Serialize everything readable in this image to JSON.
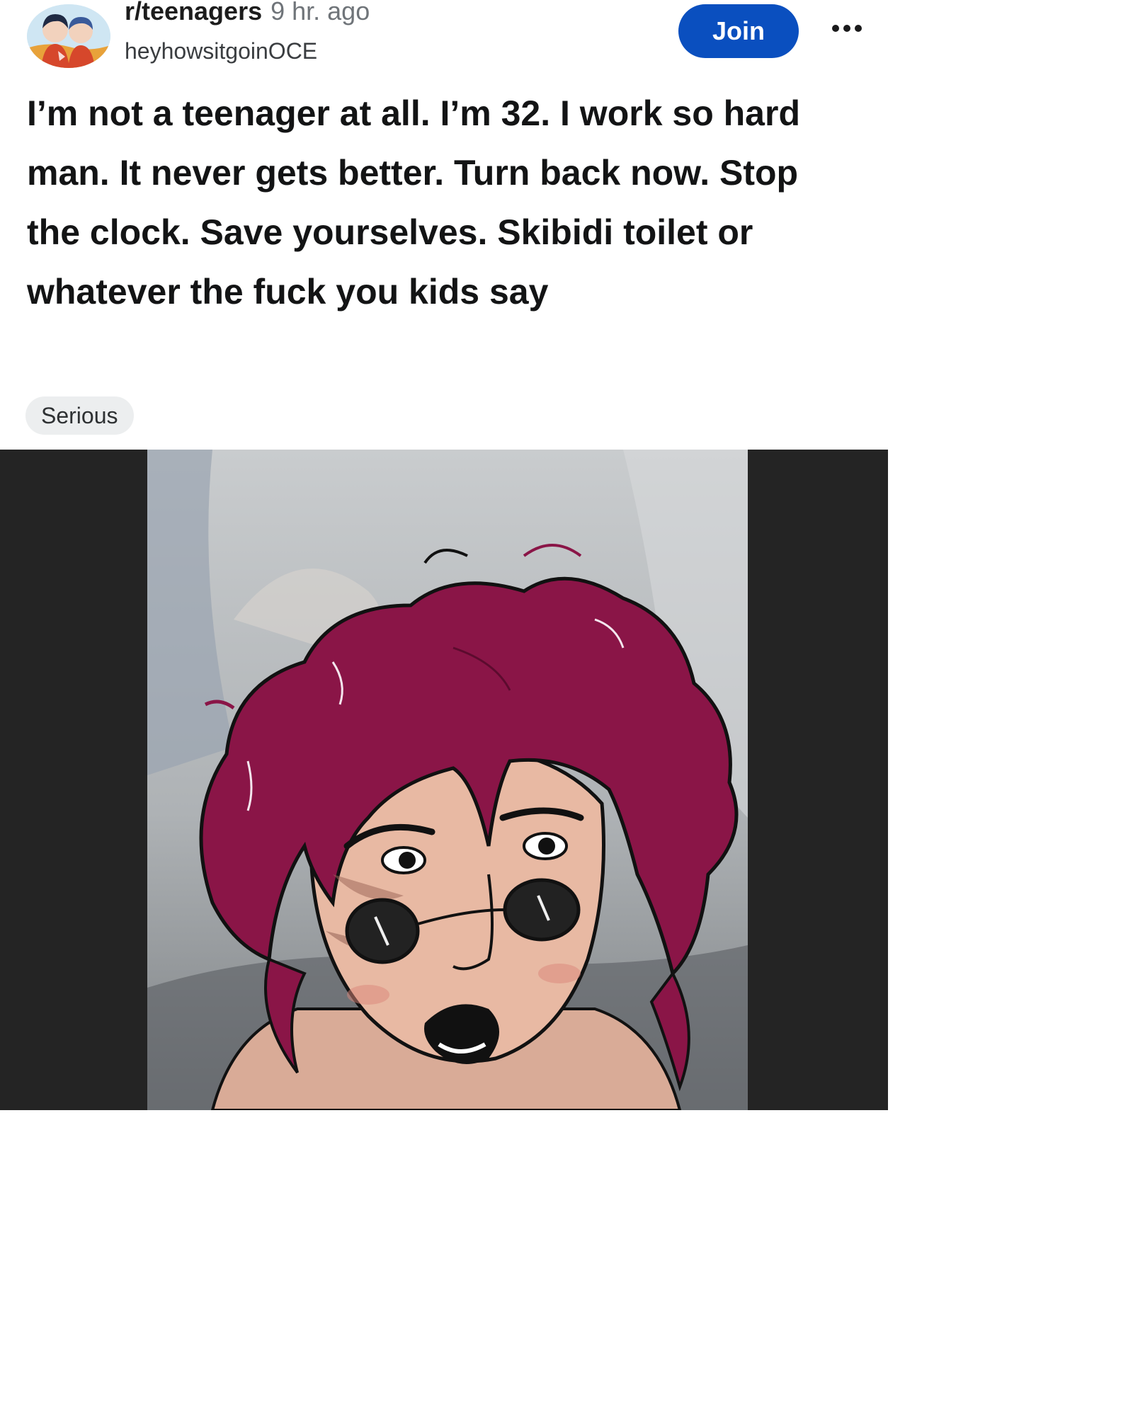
{
  "post": {
    "subreddit": "r/teenagers",
    "time_ago": "9 hr. ago",
    "username": "heyhowsitgoinOCE",
    "join_label": "Join",
    "title": "I’m not a teenager at all. I’m 32. I work so hard man. It never gets better. Turn back now. Stop the clock. Save yourselves. Skibidi toilet or whatever the fuck you kids say",
    "flair": "Serious"
  },
  "icons": {
    "more": "more-horizontal-icon",
    "avatar": "subreddit-avatar"
  },
  "colors": {
    "join_button": "#0a4fbf",
    "flair_bg": "#eceeef",
    "hair": "#8a1547",
    "skin": "#e8b9a3"
  }
}
